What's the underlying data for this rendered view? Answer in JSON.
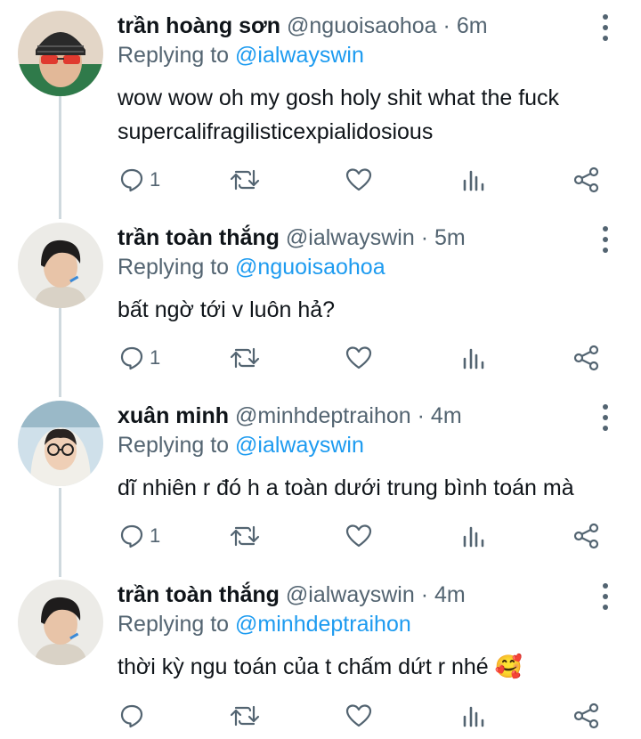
{
  "tweets": [
    {
      "name": "trần hoàng sơn",
      "handle": "@nguoisaohoa",
      "dot": "·",
      "time": "6m",
      "replying_prefix": "Replying to ",
      "replying_to": "@ialwayswin",
      "body_lines": [
        "wow wow oh my gosh holy shit what the fuck",
        "supercalifragilisticexpialidosious"
      ],
      "reply_count": "1",
      "avatar": "sunglasses-beanie"
    },
    {
      "name": "trần toàn thắng",
      "handle": "@ialwayswin",
      "dot": "·",
      "time": "5m",
      "replying_prefix": "Replying to ",
      "replying_to": "@nguoisaohoa",
      "body_lines": [
        "bất ngờ tới v luôn hả?"
      ],
      "reply_count": "1",
      "avatar": "dark-hair"
    },
    {
      "name": "xuân minh",
      "handle": "@minhdeptraihon",
      "dot": "·",
      "time": "4m",
      "replying_prefix": "Replying to ",
      "replying_to": "@ialwayswin",
      "body_lines": [
        "dĩ nhiên r đó h a toàn dưới trung bình toán mà"
      ],
      "reply_count": "1",
      "avatar": "glasses-hood"
    },
    {
      "name": "trần toàn thắng",
      "handle": "@ialwayswin",
      "dot": "·",
      "time": "4m",
      "replying_prefix": "Replying to ",
      "replying_to": "@minhdeptraihon",
      "body_lines": [
        "thời kỳ ngu toán của t chấm dứt r nhé 🥰"
      ],
      "reply_count": "",
      "avatar": "dark-hair"
    }
  ],
  "icons": {
    "reply": "reply-icon",
    "retweet": "retweet-icon",
    "like": "heart-icon",
    "views": "analytics-icon",
    "share": "share-icon",
    "more": "more-icon"
  },
  "colors": {
    "text": "#0f1419",
    "secondary": "#536471",
    "link": "#1d9bf0",
    "thread_line": "#cfd9de"
  }
}
